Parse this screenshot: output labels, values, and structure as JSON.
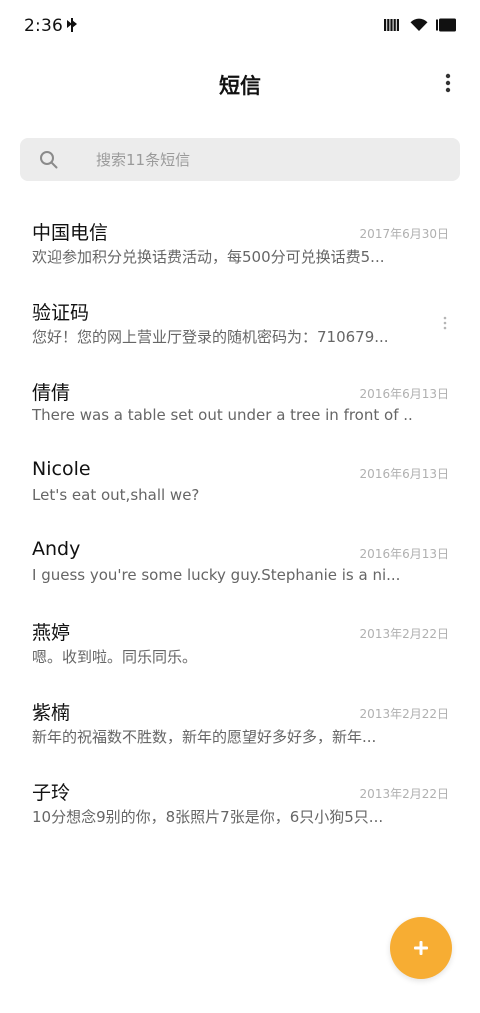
{
  "status_bar": {
    "time": "2:36",
    "icons": [
      "wireless-transfer-icon",
      "signal-icon",
      "wifi-icon",
      "battery-icon"
    ]
  },
  "header": {
    "title": "短信",
    "menu_icon": "more-vertical-icon"
  },
  "search": {
    "icon": "search-icon",
    "placeholder": "搜索11条短信"
  },
  "messages": [
    {
      "name": "中国电信",
      "date": "2017年6月30日",
      "preview": "欢迎参加积分兑换话费活动，每500分可兑换话费5..."
    },
    {
      "name": "验证码",
      "date": "",
      "preview": "您好！您的网上营业厅登录的随机密码为：710679...",
      "has_menu": true
    },
    {
      "name": "倩倩",
      "date": "2016年6月13日",
      "preview": "There was a table set out under a tree in front of ..."
    },
    {
      "name": "Nicole",
      "date": "2016年6月13日",
      "preview": "Let's eat out,shall we?"
    },
    {
      "name": "Andy",
      "date": "2016年6月13日",
      "preview": "I guess you're some lucky guy.Stephanie is a ni..."
    },
    {
      "name": "燕婷",
      "date": "2013年2月22日",
      "preview": "嗯。收到啦。同乐同乐。"
    },
    {
      "name": "紫楠",
      "date": "2013年2月22日",
      "preview": "新年的祝福数不胜数，新年的愿望好多好多，新年..."
    },
    {
      "name": "子玲",
      "date": "2013年2月22日",
      "preview": "10分想念9别的你，8张照片7张是你，6只小狗5只..."
    }
  ],
  "fab": {
    "icon": "plus-icon",
    "color": "#f7ad33"
  },
  "colors": {
    "background": "#ffffff",
    "search_bg": "#ececec",
    "accent": "#f7ad33",
    "date_text": "#b0b0b0",
    "preview_text": "#666666"
  }
}
